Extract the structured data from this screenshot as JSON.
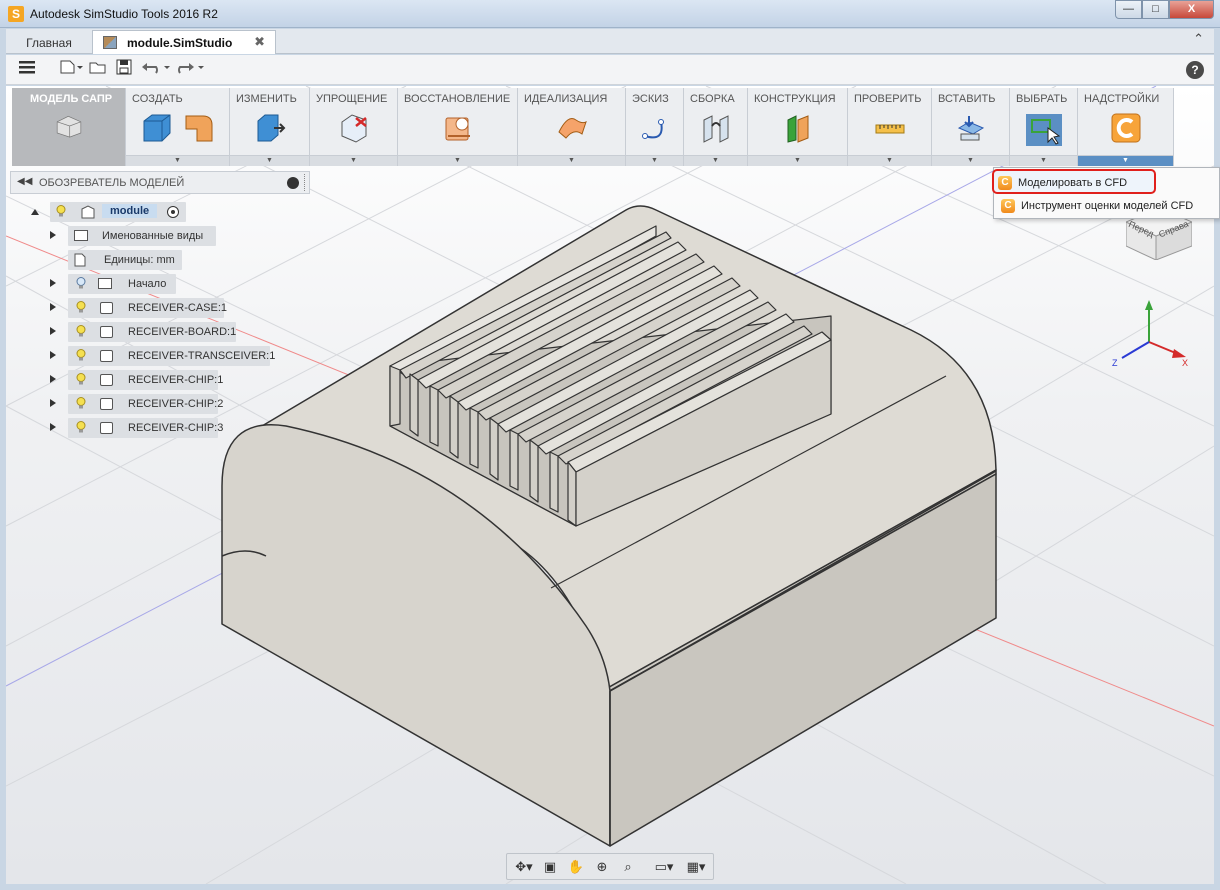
{
  "window": {
    "title": "Autodesk SimStudio Tools 2016 R2",
    "minimize": "—",
    "maximize": "□",
    "close": "X"
  },
  "tabs": {
    "home": "Главная",
    "document": "module.SimStudio",
    "close": "✖",
    "collapse": "⌃"
  },
  "help": "?",
  "ribbon": {
    "groups": [
      {
        "label": "МОДЕЛЬ САПР"
      },
      {
        "label": "СОЗДАТЬ"
      },
      {
        "label": "ИЗМЕНИТЬ"
      },
      {
        "label": "УПРОЩЕНИЕ"
      },
      {
        "label": "ВОССТАНОВЛЕНИЕ"
      },
      {
        "label": "ИДЕАЛИЗАЦИЯ"
      },
      {
        "label": "ЭСКИЗ"
      },
      {
        "label": "СБОРКА"
      },
      {
        "label": "КОНСТРУКЦИЯ"
      },
      {
        "label": "ПРОВЕРИТЬ"
      },
      {
        "label": "ВСТАВИТЬ"
      },
      {
        "label": "ВЫБРАТЬ"
      },
      {
        "label": "НАДСТРОЙКИ"
      }
    ],
    "dropdown_glyph": "▼"
  },
  "browser": {
    "title": "ОБОЗРЕВАТЕЛЬ МОДЕЛЕЙ",
    "collapse_glyph": "◀◀",
    "root": "module",
    "items": [
      {
        "label": "Именованные виды"
      },
      {
        "label": "Единицы: mm"
      },
      {
        "label": "Начало"
      },
      {
        "label": "RECEIVER-CASE:1"
      },
      {
        "label": "RECEIVER-BOARD:1"
      },
      {
        "label": "RECEIVER-TRANSCEIVER:1"
      },
      {
        "label": "RECEIVER-CHIP:1"
      },
      {
        "label": "RECEIVER-CHIP:2"
      },
      {
        "label": "RECEIVER-CHIP:3"
      }
    ]
  },
  "addins_menu": {
    "items": [
      {
        "label": "Моделировать в CFD",
        "highlighted": true
      },
      {
        "label": "Инструмент оценки моделей CFD"
      }
    ]
  },
  "viewcube": {
    "front": "Перед",
    "right": "Справа"
  },
  "axes": {
    "x": "X",
    "y": "Y",
    "z": "Z"
  },
  "colors": {
    "accent": "#5b8fc4",
    "highlight_border": "#e0201c",
    "model_face": "#d8d6d0"
  }
}
